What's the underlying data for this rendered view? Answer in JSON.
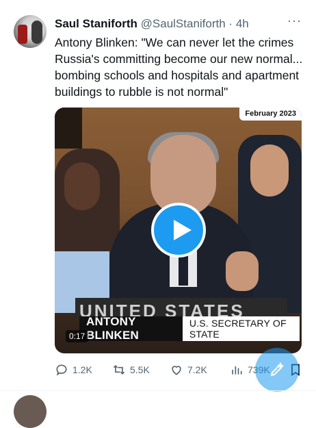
{
  "tweet": {
    "author_name": "Saul Staniforth",
    "handle": "@SaulStaniforth",
    "separator": "·",
    "time": "4h",
    "more": "···",
    "text": "Antony Blinken: \"We can never let the crimes Russia's committing become our new normal... bombing schools and hospitals and apartment buildings to rubble is not normal\""
  },
  "video": {
    "date_badge": "February 2023",
    "banner_bg_text": "UNITED STATES",
    "banner_name": "ANTONY BLINKEN",
    "banner_title": "U.S. SECRETARY OF STATE",
    "duration": "0:17"
  },
  "actions": {
    "replies": "1.2K",
    "retweets": "5.5K",
    "likes": "7.2K",
    "views": "739K"
  },
  "colors": {
    "accent": "#1d9bf0",
    "secondary_text": "#536471",
    "primary_text": "#0f1419"
  },
  "icons": [
    "more-icon",
    "play-icon",
    "reply-icon",
    "retweet-icon",
    "like-icon",
    "views-icon",
    "bookmark-icon",
    "compose-icon"
  ]
}
